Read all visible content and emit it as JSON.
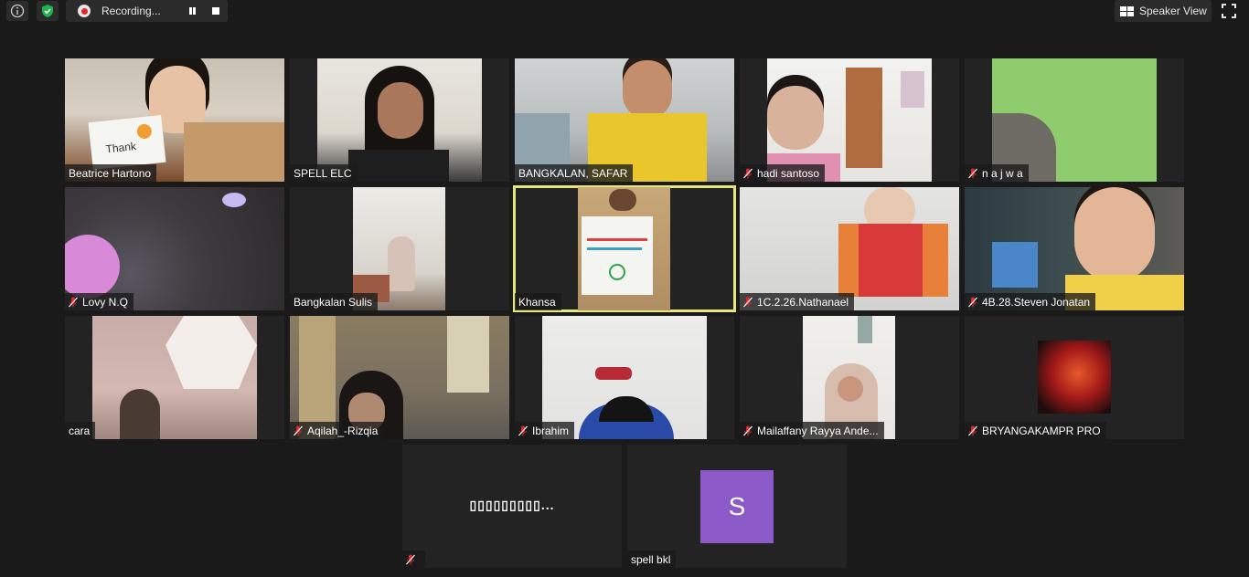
{
  "top_bar": {
    "recording_label": "Recording...",
    "speaker_view_label": "Speaker View"
  },
  "participants": [
    {
      "name": "Beatrice Hartono",
      "muted": false,
      "card_text": "Thank"
    },
    {
      "name": "SPELL ELC",
      "muted": false
    },
    {
      "name": "BANGKALAN, SAFAR",
      "muted": false
    },
    {
      "name": "hadi santoso",
      "muted": true
    },
    {
      "name": "n a j w a",
      "muted": true
    },
    {
      "name": "Lovy N.Q",
      "muted": true
    },
    {
      "name": "Bangkalan Sulis",
      "muted": false
    },
    {
      "name": "Khansa",
      "muted": false,
      "active_speaker": true
    },
    {
      "name": "1C.2.26.Nathanael",
      "muted": true
    },
    {
      "name": "4B.28.Steven Jonatan",
      "muted": true
    },
    {
      "name": "cara",
      "muted": false
    },
    {
      "name": "Aqilah_-Rizqia",
      "muted": true
    },
    {
      "name": "Ibrahim",
      "muted": true
    },
    {
      "name": "Mailaffany Rayya Ande...",
      "muted": true
    },
    {
      "name": "BRYANGAKAMPR PRO",
      "muted": true
    },
    {
      "name": "",
      "muted": true,
      "center_text": "▯▯▯▯▯▯▯▯▯..."
    },
    {
      "name": "spell bkl",
      "muted": false,
      "avatar_letter": "S",
      "avatar_color": "#8c5ac8"
    }
  ],
  "colors": {
    "background": "#1a1a1a",
    "tile": "#232323",
    "active_border": "#e6e67a",
    "mute_red": "#e02828"
  }
}
